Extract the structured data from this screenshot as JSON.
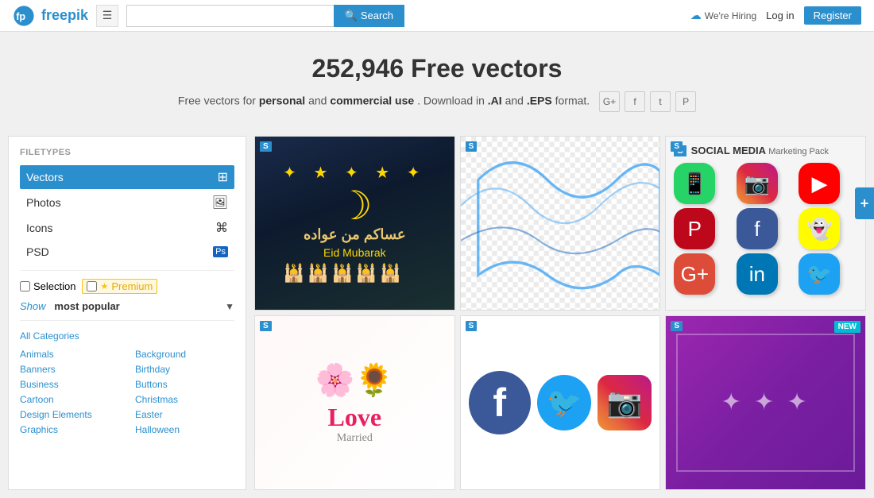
{
  "header": {
    "logo_text": "freepik",
    "hamburger_label": "☰",
    "search_placeholder": "",
    "search_button": "Search",
    "we_hiring": "We're Hiring",
    "login": "Log in",
    "register": "Register"
  },
  "hero": {
    "title": "252,946 Free vectors",
    "subtitle_start": "Free vectors for ",
    "subtitle_bold1": "personal",
    "subtitle_mid": " and ",
    "subtitle_bold2": "commercial use",
    "subtitle_end": ". Download in ",
    "format1": ".AI",
    "and_text": " and ",
    "format2": ".EPS",
    "format_end": " format."
  },
  "social_icons": [
    {
      "label": "G+",
      "name": "google-plus"
    },
    {
      "label": "f",
      "name": "facebook"
    },
    {
      "label": "t",
      "name": "twitter"
    },
    {
      "label": "P",
      "name": "pinterest"
    }
  ],
  "sidebar": {
    "filetypes_label": "FILETYPES",
    "items": [
      {
        "label": "Vectors",
        "icon": "⊞",
        "active": true
      },
      {
        "label": "Photos",
        "icon": "🖼",
        "active": false
      },
      {
        "label": "Icons",
        "icon": "⌘",
        "active": false
      },
      {
        "label": "PSD",
        "icon": "Ps",
        "active": false
      }
    ],
    "selection_checkbox": "Selection",
    "premium_label": "Premium",
    "show_label": "Show",
    "most_popular": "most popular",
    "categories_title": "All Categories",
    "categories_col1": [
      "Animals",
      "Banners",
      "Business",
      "Cartoon",
      "Design Elements",
      "Graphics"
    ],
    "categories_col2": [
      "Background",
      "Birthday",
      "Buttons",
      "Christmas",
      "Easter",
      "Halloween"
    ]
  },
  "cards": [
    {
      "id": "eid",
      "badge": "S",
      "title": "Eid Mubarak",
      "arabic": "عساكم من عواده",
      "sub": "Eid Mubarak"
    },
    {
      "id": "wave",
      "badge": "S"
    },
    {
      "id": "social-media",
      "badge": "S",
      "title": "SOCIAL MEDIA",
      "subtitle": "Marketing Pack"
    },
    {
      "id": "love",
      "badge": "S",
      "title": "Love Married"
    },
    {
      "id": "social2",
      "badge": "S"
    },
    {
      "id": "pattern",
      "badge": "S",
      "new_badge": "NEW"
    }
  ],
  "colors": {
    "primary": "#2b8fce",
    "whatsapp": "#25d366",
    "instagram": "#e1306c",
    "youtube": "#ff0000",
    "pinterest": "#bd081c",
    "facebook": "#3b5998",
    "snapchat": "#fffc00",
    "google_plus": "#dd4b39",
    "linkedin": "#0077b5",
    "twitter": "#1da1f2"
  }
}
